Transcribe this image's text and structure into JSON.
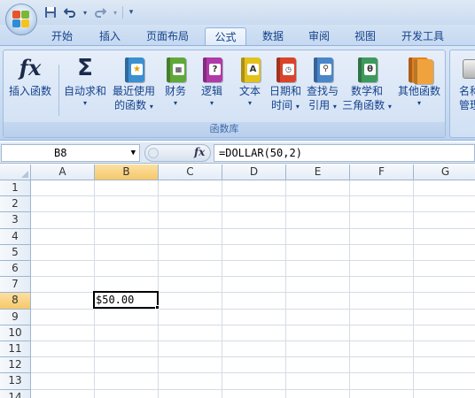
{
  "quick_access": {
    "save_icon": "save-icon",
    "undo_icon": "undo-icon",
    "redo_icon": "redo-icon",
    "customize_icon": "customize-qat-icon"
  },
  "tabs": [
    {
      "label": "开始"
    },
    {
      "label": "插入"
    },
    {
      "label": "页面布局"
    },
    {
      "label": "公式"
    },
    {
      "label": "数据"
    },
    {
      "label": "审阅"
    },
    {
      "label": "视图"
    },
    {
      "label": "开发工具"
    }
  ],
  "active_tab": "公式",
  "ribbon": {
    "group_label": "函数库",
    "insert_function": {
      "label": "插入函数",
      "icon": "fx"
    },
    "autosum": {
      "line1": "自动求和",
      "icon": "Σ"
    },
    "recent": {
      "line1": "最近使用",
      "line2": "的函数"
    },
    "financial": {
      "line1": "财务"
    },
    "logical": {
      "line1": "逻辑"
    },
    "text": {
      "line1": "文本"
    },
    "datetime": {
      "line1": "日期和",
      "line2": "时间"
    },
    "lookup": {
      "line1": "查找与",
      "line2": "引用"
    },
    "math": {
      "line1": "数学和",
      "line2": "三角函数"
    },
    "more": {
      "line1": "其他函数"
    },
    "name_manager": {
      "line1": "名称",
      "line2": "管理"
    },
    "book_glyphs": {
      "logical": "?",
      "text": "A",
      "math": "θ"
    },
    "colors": {
      "recent": "#3c8fd0",
      "financial": "#5fa83a",
      "logical": "#b03aa8",
      "text": "#e3c21d",
      "datetime": "#d9442a",
      "lookup": "#4a86c8",
      "math": "#3e9a5c",
      "more": "#e77d1f"
    }
  },
  "formula_bar": {
    "name_box": "B8",
    "fx_label": "fx",
    "formula": "=DOLLAR(50,2)"
  },
  "sheet": {
    "columns": [
      "A",
      "B",
      "C",
      "D",
      "E",
      "F",
      "G"
    ],
    "rows": [
      "1",
      "2",
      "3",
      "4",
      "5",
      "6",
      "7",
      "8",
      "9",
      "10",
      "11",
      "12",
      "13",
      "14"
    ],
    "selected_column": "B",
    "selected_row": "8",
    "cell_B8": "$50.00"
  }
}
